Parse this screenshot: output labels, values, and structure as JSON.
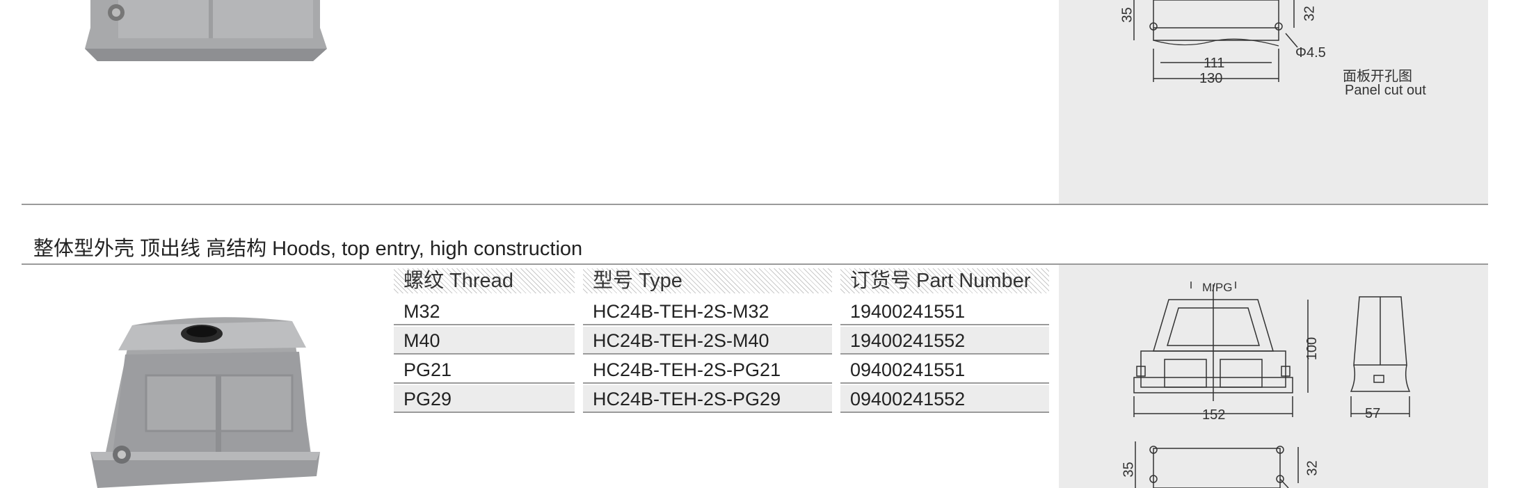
{
  "section_title": "整体型外壳 顶出线 高结构 Hoods, top entry, high construction",
  "table": {
    "headers": [
      "螺纹 Thread",
      "型号 Type",
      "订货号 Part Number"
    ],
    "rows": [
      [
        "M32",
        "HC24B-TEH-2S-M32",
        "19400241551"
      ],
      [
        "M40",
        "HC24B-TEH-2S-M40",
        "19400241552"
      ],
      [
        "PG21",
        "HC24B-TEH-2S-PG21",
        "09400241551"
      ],
      [
        "PG29",
        "HC24B-TEH-2S-PG29",
        "09400241552"
      ]
    ]
  },
  "top_drawing": {
    "dim_35": "35",
    "dim_32": "32",
    "dim_111": "111",
    "dim_130": "130",
    "hole": "Φ4.5",
    "caption_cn": "面板开孔图",
    "caption_en": "Panel cut out"
  },
  "bottom_drawing": {
    "mpg": "M/PG",
    "dim_100": "100",
    "dim_152": "152",
    "dim_57": "57",
    "dim_35": "35",
    "dim_32": "32"
  },
  "colors": {
    "panel_bg": "#ebebeb",
    "divider": "#9a9a9a",
    "hood_gray": "#a8a9ab"
  }
}
